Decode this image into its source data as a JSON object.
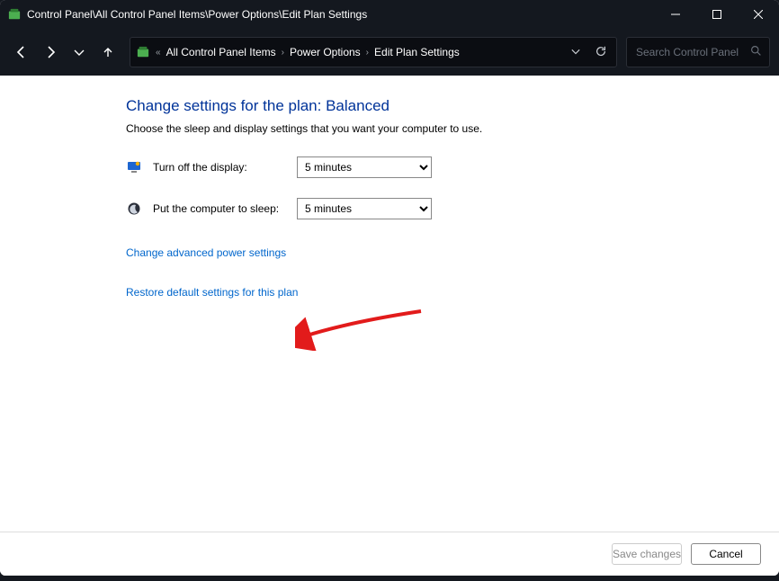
{
  "titlebar": {
    "title": "Control Panel\\All Control Panel Items\\Power Options\\Edit Plan Settings"
  },
  "breadcrumb": {
    "items": [
      "All Control Panel Items",
      "Power Options",
      "Edit Plan Settings"
    ]
  },
  "search": {
    "placeholder": "Search Control Panel"
  },
  "page": {
    "heading": "Change settings for the plan: Balanced",
    "subtitle": "Choose the sleep and display settings that you want your computer to use."
  },
  "settings": {
    "display_label": "Turn off the display:",
    "display_value": "5 minutes",
    "sleep_label": "Put the computer to sleep:",
    "sleep_value": "5 minutes"
  },
  "links": {
    "advanced": "Change advanced power settings",
    "restore": "Restore default settings for this plan"
  },
  "buttons": {
    "save": "Save changes",
    "cancel": "Cancel"
  }
}
